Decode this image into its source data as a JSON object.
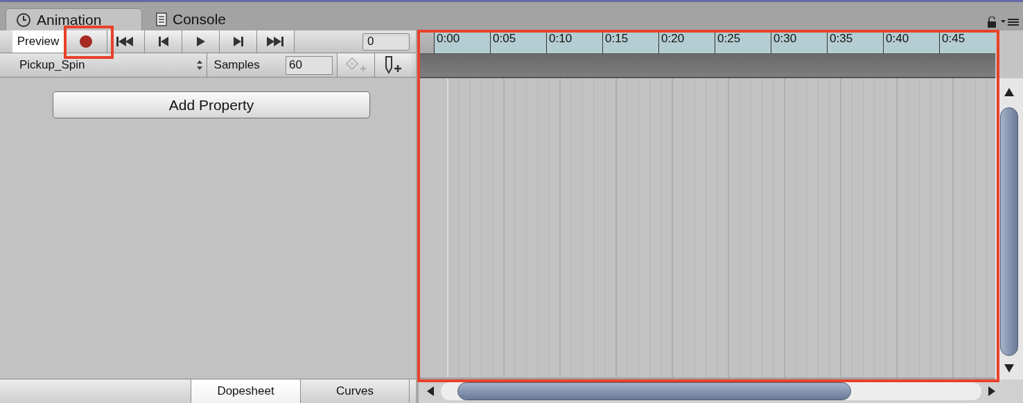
{
  "tabs": [
    {
      "label": "Animation",
      "kind": "clock",
      "selected": true
    },
    {
      "label": "Console",
      "kind": "log",
      "selected": false
    }
  ],
  "toolbar": {
    "buttons": [
      {
        "kind": "preview",
        "label": "Preview",
        "selected": true
      },
      {
        "kind": "record",
        "selected": false
      },
      {
        "kind": "first",
        "selected": false
      },
      {
        "kind": "prev",
        "selected": false
      },
      {
        "kind": "play",
        "selected": false
      },
      {
        "kind": "next",
        "selected": false
      },
      {
        "kind": "last",
        "selected": false
      }
    ],
    "frame": "0"
  },
  "clip_row": {
    "clip": "Pickup_Spin",
    "samples_label": "Samples",
    "samples": "60",
    "key_buttons": [
      {
        "kind": "add-key",
        "disabled": true
      },
      {
        "kind": "add-event",
        "disabled": false
      }
    ]
  },
  "add_property": "Add Property",
  "view_tabs": [
    {
      "label": "Dopesheet",
      "selected": true
    },
    {
      "label": "Curves",
      "selected": false
    }
  ],
  "ruler": [
    "0:00",
    "0:05",
    "0:10",
    "0:15",
    "0:20",
    "0:25",
    "0:30",
    "0:35",
    "0:40",
    "0:45"
  ]
}
